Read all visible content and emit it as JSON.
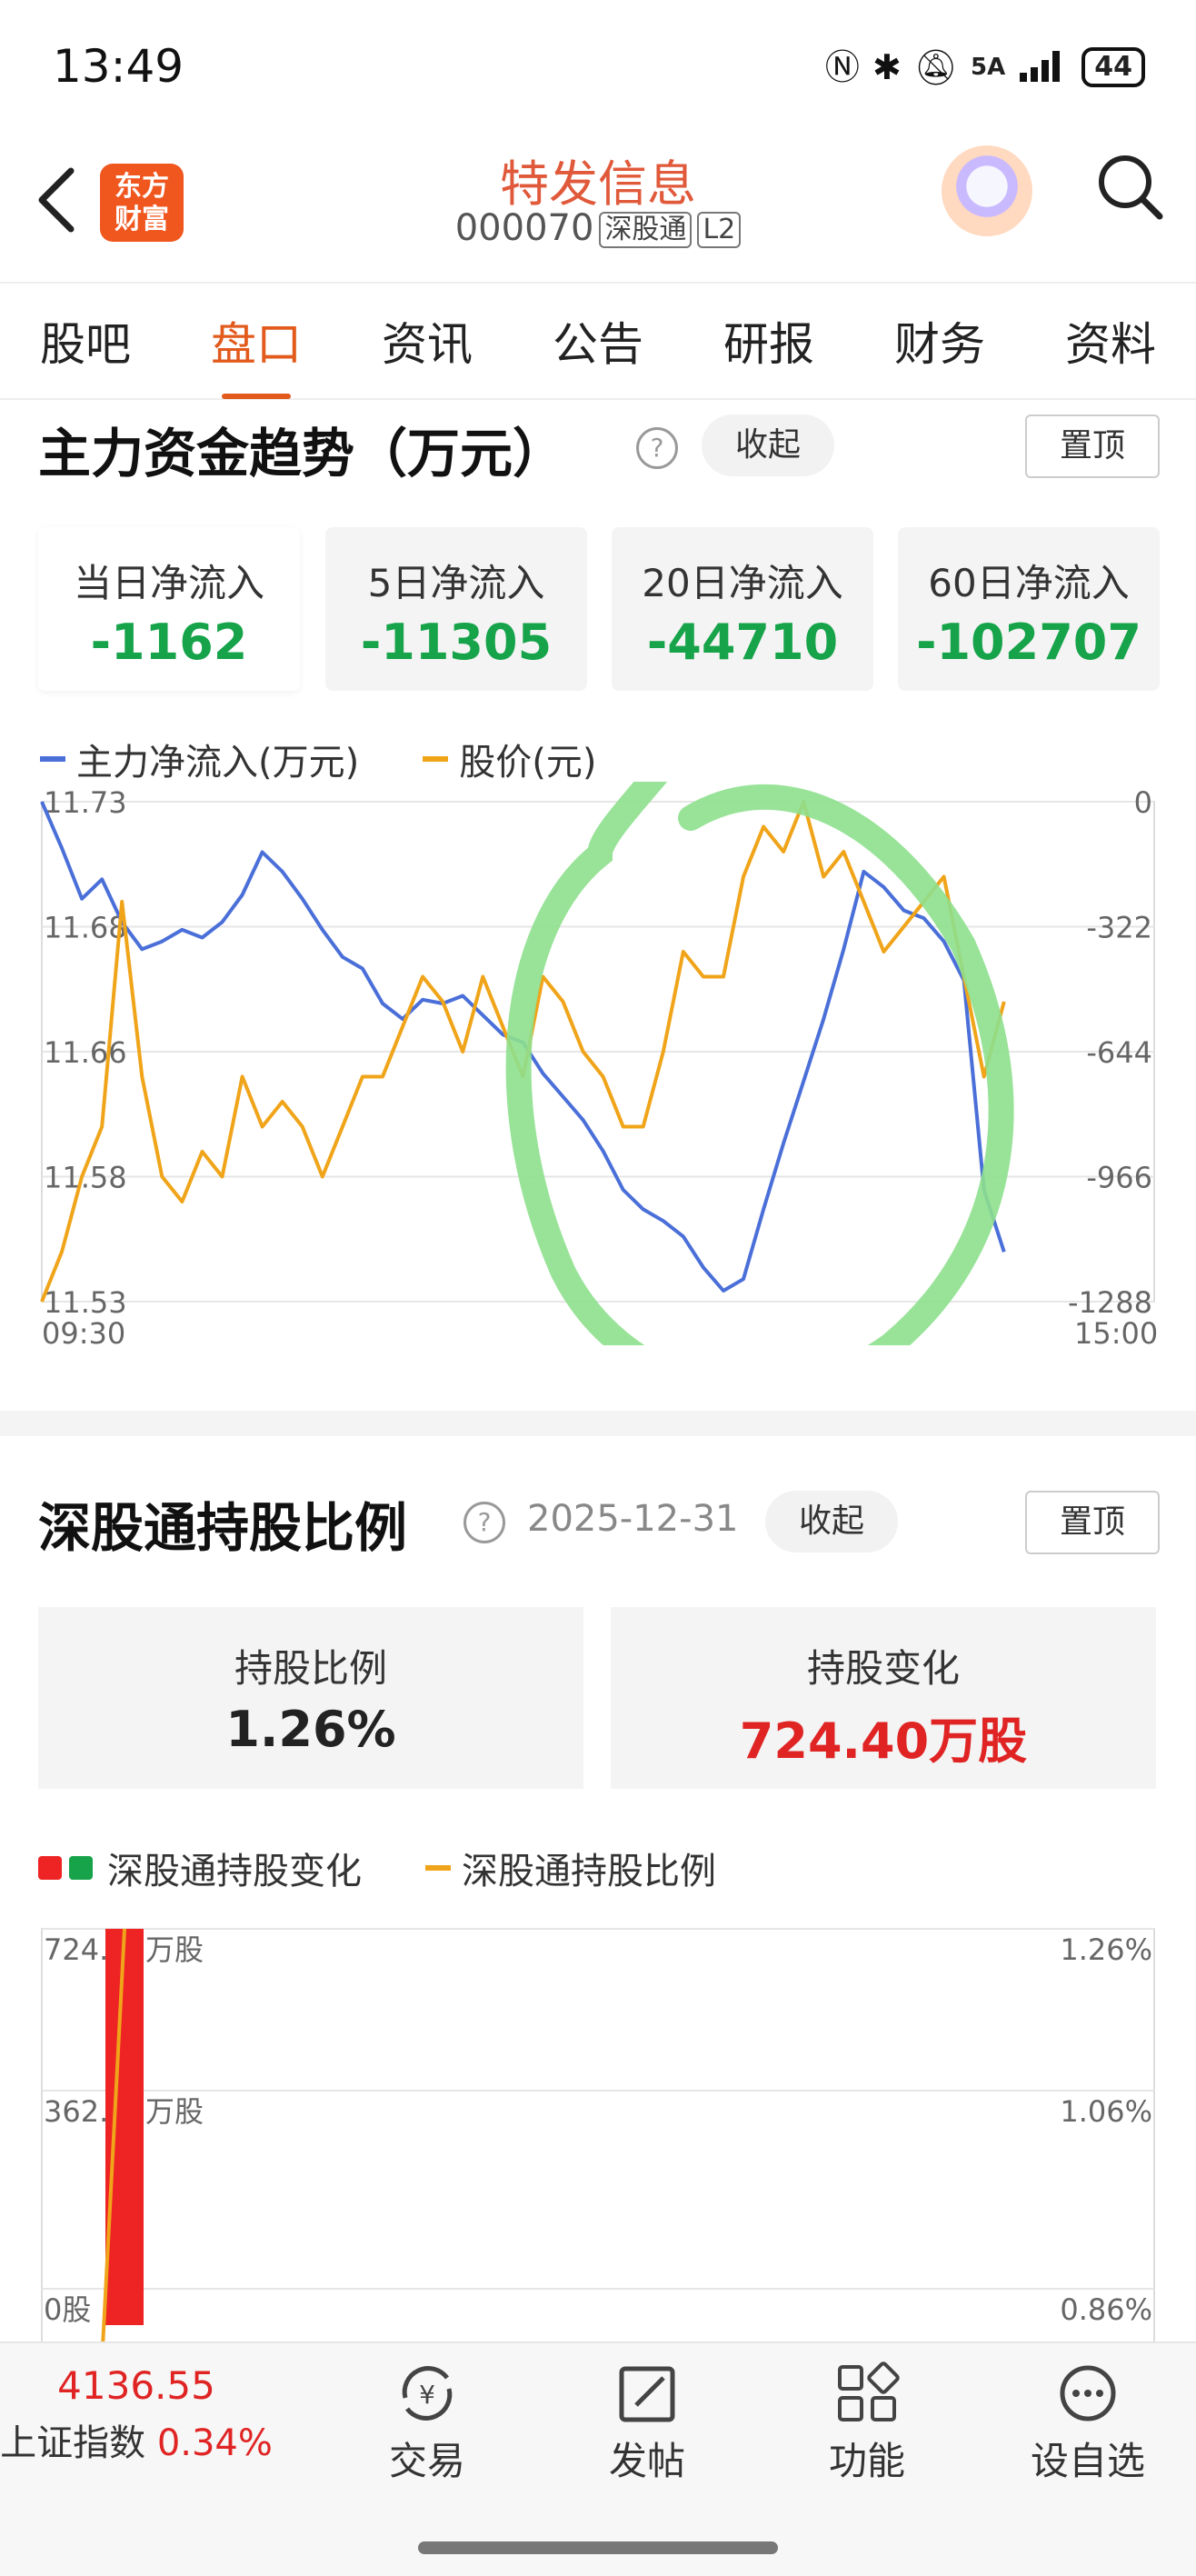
{
  "status_bar": {
    "time": "13:49",
    "network": "5A",
    "battery": "44"
  },
  "header": {
    "logo_text": "东方财富",
    "stock_name": "特发信息",
    "stock_code": "000070",
    "tag_connect": "深股通",
    "tag_level": "L2"
  },
  "tabs": [
    {
      "label": "股吧",
      "active": false
    },
    {
      "label": "盘口",
      "active": true
    },
    {
      "label": "资讯",
      "active": false
    },
    {
      "label": "公告",
      "active": false
    },
    {
      "label": "研报",
      "active": false
    },
    {
      "label": "财务",
      "active": false
    },
    {
      "label": "资料",
      "active": false
    }
  ],
  "capital_section": {
    "title": "主力资金趋势（万元）",
    "collapse_label": "收起",
    "pin_label": "置顶",
    "cards": [
      {
        "label": "当日净流入",
        "value": "-1162"
      },
      {
        "label": "5日净流入",
        "value": "-11305"
      },
      {
        "label": "20日净流入",
        "value": "-44710"
      },
      {
        "label": "60日净流入",
        "value": "-102707"
      }
    ],
    "legend_flow": "主力净流入(万元)",
    "legend_price": "股价(元)",
    "x_start": "09:30",
    "x_end": "15:00",
    "left_ticks": [
      "11.73",
      "11.68",
      "11.66",
      "11.58",
      "11.53"
    ],
    "right_ticks": [
      "0",
      "-322",
      "-644",
      "-966",
      "-1288"
    ]
  },
  "chart_data": [
    {
      "type": "line",
      "title": "",
      "xlabel": "",
      "ylabel": "",
      "x_range": [
        "09:30",
        "15:00"
      ],
      "grid": true,
      "legend": "top-left",
      "series": [
        {
          "name": "主力净流入(万元)",
          "axis": "right",
          "ylim": [
            -1288,
            0
          ],
          "color": "#4a6fd8",
          "values": [
            0,
            -120,
            -250,
            -200,
            -310,
            -380,
            -360,
            -330,
            -350,
            -310,
            -240,
            -130,
            -180,
            -250,
            -330,
            -400,
            -430,
            -520,
            -560,
            -510,
            -520,
            -500,
            -550,
            -600,
            -620,
            -700,
            -760,
            -820,
            -900,
            -1000,
            -1050,
            -1080,
            -1120,
            -1200,
            -1260,
            -1230,
            -1050,
            -880,
            -720,
            -560,
            -380,
            -180,
            -220,
            -280,
            -300,
            -360,
            -460,
            -1000,
            -1160
          ]
        },
        {
          "name": "股价(元)",
          "axis": "left",
          "ylim": [
            11.53,
            11.73
          ],
          "color": "#f0a419",
          "values": [
            11.53,
            11.55,
            11.58,
            11.6,
            11.69,
            11.62,
            11.58,
            11.57,
            11.59,
            11.58,
            11.62,
            11.6,
            11.61,
            11.6,
            11.58,
            11.6,
            11.62,
            11.62,
            11.64,
            11.66,
            11.65,
            11.63,
            11.66,
            11.64,
            11.62,
            11.66,
            11.65,
            11.63,
            11.62,
            11.6,
            11.6,
            11.63,
            11.67,
            11.66,
            11.66,
            11.7,
            11.72,
            11.71,
            11.73,
            11.7,
            11.71,
            11.69,
            11.67,
            11.68,
            11.69,
            11.7,
            11.66,
            11.62,
            11.65
          ]
        }
      ]
    },
    {
      "type": "bar",
      "title": "",
      "xlabel": "",
      "ylabel": "",
      "grid": true,
      "legend": "top-left",
      "series": [
        {
          "name": "深股通持股变化",
          "axis": "left",
          "ylim": [
            0,
            724.4
          ],
          "unit": "万股",
          "values": [
            724.4
          ],
          "color": "#ee2424"
        },
        {
          "name": "深股通持股比例",
          "axis": "right",
          "ylim": [
            0.86,
            1.26
          ],
          "unit": "%",
          "values": [
            0.66,
            1.26
          ],
          "color": "#f0a419"
        }
      ]
    }
  ],
  "shgt_section": {
    "title": "深股通持股比例",
    "date": "2025-12-31",
    "collapse_label": "收起",
    "pin_label": "置顶",
    "ratio_label": "持股比例",
    "ratio_value": "1.26%",
    "change_label": "持股变化",
    "change_value": "724.40万股",
    "legend_change": "深股通持股变化",
    "legend_ratio": "深股通持股比例",
    "left_ticks": [
      "724.40万股",
      "362.20万股",
      "0股"
    ],
    "right_ticks": [
      "1.26%",
      "1.06%",
      "0.86%"
    ]
  },
  "bottom_bar": {
    "index_value": "4136.55",
    "index_name": "上证指数",
    "index_change": "0.34%",
    "items": [
      "交易",
      "发帖",
      "功能",
      "设自选"
    ]
  },
  "colors": {
    "accent": "#e25a1c",
    "negative": "#16a34a",
    "positive": "#e02424",
    "flow_line": "#4a6fd8",
    "price_line": "#f0a419",
    "annotation_circle": "#8ee08e"
  }
}
